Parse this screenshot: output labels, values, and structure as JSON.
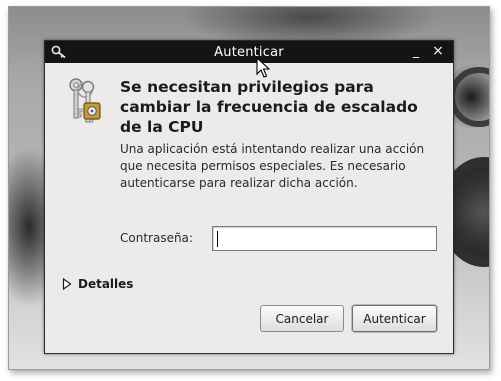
{
  "window": {
    "title": "Autenticar",
    "minimize_glyph": "_",
    "close_glyph": "×"
  },
  "dialog": {
    "heading": "Se necesitan privilegios para cambiar la frecuencia de escalado de la CPU",
    "description": "Una aplicación está intentando realizar una acción que necesita permisos especiales. Es necesario autenticarse para realizar dicha acción.",
    "password_label": "Contraseña:",
    "password_value": "",
    "details_label": "Detalles",
    "cancel_label": "Cancelar",
    "authenticate_label": "Autenticar"
  },
  "icons": {
    "titlebar": "keys-icon",
    "dialog": "keyring-icon",
    "details": "expander-triangle-icon",
    "pointer": "mouse-pointer-icon"
  },
  "colors": {
    "titlebar": "#141414",
    "dialog_bg": "#edebe9",
    "text": "#1b1b1b"
  }
}
